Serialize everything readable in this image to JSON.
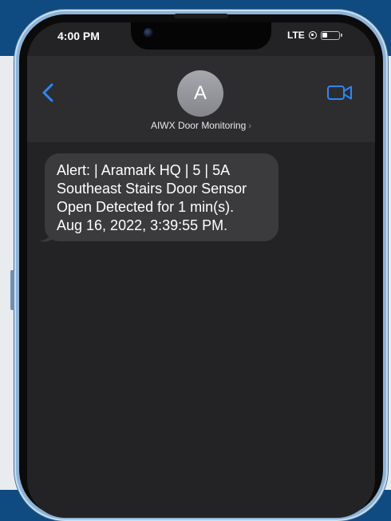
{
  "status_bar": {
    "time": "4:00 PM",
    "network": "LTE",
    "icons": [
      "orientation-lock-icon",
      "battery-icon"
    ]
  },
  "header": {
    "back_icon": "chevron-left-icon",
    "avatar_initial": "A",
    "contact_name": "AIWX Door Monitoring",
    "contact_chevron": "›",
    "video_icon": "video-camera-icon"
  },
  "messages": [
    {
      "lines": [
        "Alert: | Aramark HQ | 5 | 5A",
        "Southeast Stairs Door Sensor",
        "Open Detected for 1 min(s).",
        "Aug 16, 2022, 3:39:55 PM."
      ]
    }
  ],
  "colors": {
    "accent": "#3b82f6",
    "bubble": "#3b3b3e",
    "background": "#232325"
  }
}
